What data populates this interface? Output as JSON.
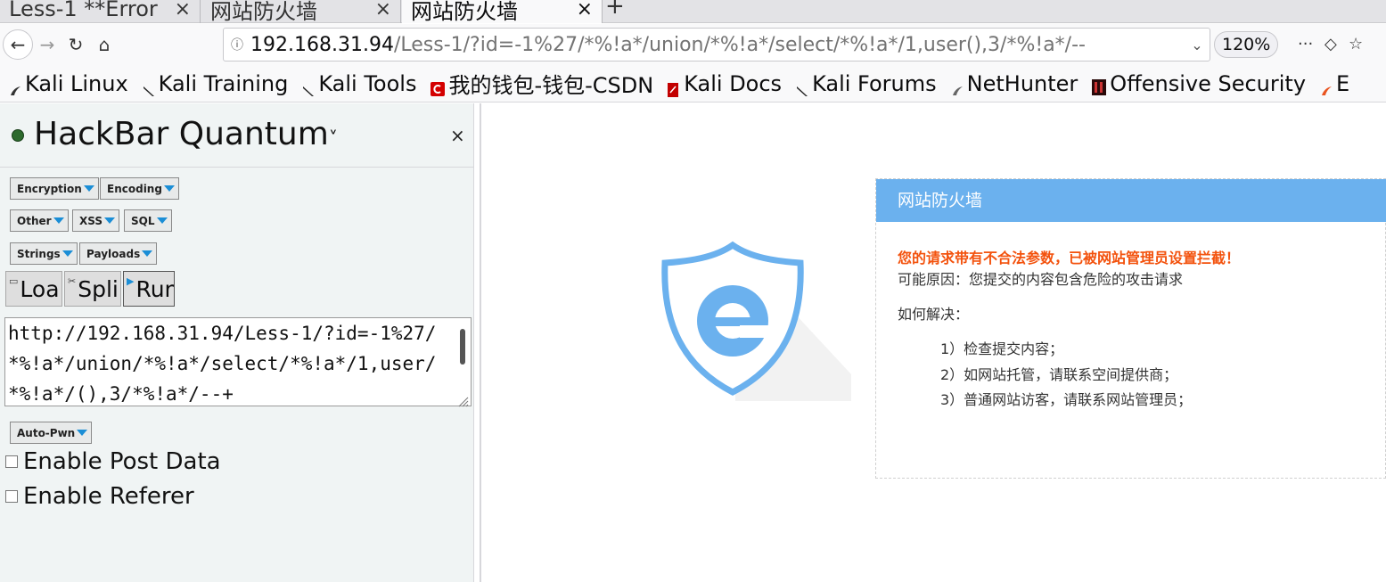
{
  "tabs": [
    {
      "title": "Less-1 **Error",
      "close": "×"
    },
    {
      "title": "网站防火墙",
      "close": "×"
    },
    {
      "title": "网站防火墙",
      "close": "×"
    }
  ],
  "new_tab_label": "+",
  "nav": {
    "back_icon": "←",
    "forward_icon": "→",
    "reload_icon": "↻",
    "home_icon": "⌂",
    "info_icon": "ⓘ",
    "url_host": "192.168.31.94",
    "url_path": "/Less-1/?id=-1%27/*%!a*/union/*%!a*/select/*%!a*/1,user(),3/*%!a*/--",
    "url_dropdown": "⌄",
    "zoom": "120%",
    "menu_icon": "···",
    "pocket_icon": "◇",
    "star_icon": "☆"
  },
  "bookmarks": [
    {
      "label": "Kali Linux",
      "color": "#222"
    },
    {
      "label": "Kali Training",
      "color": "#222"
    },
    {
      "label": "Kali Tools",
      "color": "#222"
    },
    {
      "label": "我的钱包-钱包-CSDN",
      "color": "#d40000"
    },
    {
      "label": "Kali Docs",
      "color": "#c20000"
    },
    {
      "label": "Kali Forums",
      "color": "#222"
    },
    {
      "label": "NetHunter",
      "color": "#555"
    },
    {
      "label": "Offensive Security",
      "color": "#7a1313"
    },
    {
      "label": "E",
      "color": "#e95420"
    }
  ],
  "hackbar": {
    "title": "HackBar Quantum",
    "title_caret": "˅",
    "close": "×",
    "menus": {
      "encryption": "Encryption",
      "encoding": "Encoding",
      "other": "Other",
      "xss": "XSS",
      "sql": "SQL",
      "strings": "Strings",
      "payloads": "Payloads",
      "autopwn": "Auto-Pwn"
    },
    "load_label": "Loa",
    "split_label": "Spli",
    "run_label": "Run",
    "url_value": "http://192.168.31.94/Less-1/?id=-1%27/*%!a*/union/*%!a*/select/*%!a*/1,user/*%!a*/(),3/*%!a*/--+",
    "enable_post": "Enable Post Data",
    "enable_referer": "Enable Referer"
  },
  "waf": {
    "header": "网站防火墙",
    "alert": "您的请求带有不合法参数，已被网站管理员设置拦截！",
    "reason": "可能原因：您提交的内容包含危险的攻击请求",
    "how": "如何解决：",
    "steps": [
      "1）检查提交内容；",
      "2）如网站托管，请联系空间提供商；",
      "3）普通网站访客，请联系网站管理员；"
    ],
    "accent": "#6bb1ee",
    "alert_color": "#f3520d"
  }
}
